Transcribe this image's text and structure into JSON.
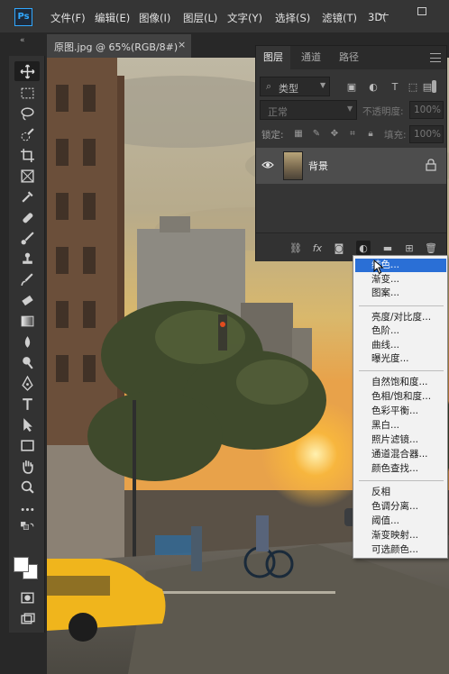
{
  "app": {
    "logo": "Ps",
    "menus": [
      "文件(F)",
      "编辑(E)",
      "图像(I)",
      "图层(L)",
      "文字(Y)",
      "选择(S)",
      "滤镜(T)",
      "3D("
    ]
  },
  "document": {
    "tab_label": "原图.jpg @ 65%(RGB/8#)",
    "close_glyph": "×"
  },
  "toolbar": {
    "collapse_glyph": "«",
    "tools": [
      "move-icon",
      "marquee-icon",
      "lasso-icon",
      "quick-select-icon",
      "crop-icon",
      "frame-icon",
      "eyedropper-icon",
      "healing-brush-icon",
      "brush-icon",
      "clone-stamp-icon",
      "history-brush-icon",
      "eraser-icon",
      "gradient-icon",
      "blur-icon",
      "dodge-icon",
      "pen-icon",
      "type-icon",
      "path-select-icon",
      "rectangle-icon",
      "hand-icon",
      "zoom-icon",
      "more-tools-icon"
    ]
  },
  "layers_panel": {
    "tabs": [
      "图层",
      "通道",
      "路径"
    ],
    "filter_label": "类型",
    "blend_mode": "正常",
    "opacity_label": "不透明度:",
    "opacity_value": "100%",
    "lock_label": "锁定:",
    "fill_label": "填充:",
    "fill_value": "100%",
    "layer_name": "背景",
    "bottom_icons": [
      "link-icon",
      "fx-icon",
      "mask-icon",
      "adjustment-icon",
      "folder-icon",
      "new-layer-icon",
      "trash-icon"
    ]
  },
  "adjustment_menu": {
    "groups": [
      [
        "纯色...",
        "渐变...",
        "图案..."
      ],
      [
        "亮度/对比度...",
        "色阶...",
        "曲线...",
        "曝光度..."
      ],
      [
        "自然饱和度...",
        "色相/饱和度...",
        "色彩平衡...",
        "黑白...",
        "照片滤镜...",
        "通道混合器...",
        "颜色查找..."
      ],
      [
        "反相",
        "色调分离...",
        "阈值...",
        "渐变映射...",
        "可选颜色..."
      ]
    ],
    "highlighted": "纯色..."
  },
  "colors": {
    "accent": "#31a8ff",
    "menu_highlight": "#2a6fd6",
    "ui_dark": "#353535",
    "panel": "#353535",
    "selected_layer": "#4d4d4d"
  }
}
